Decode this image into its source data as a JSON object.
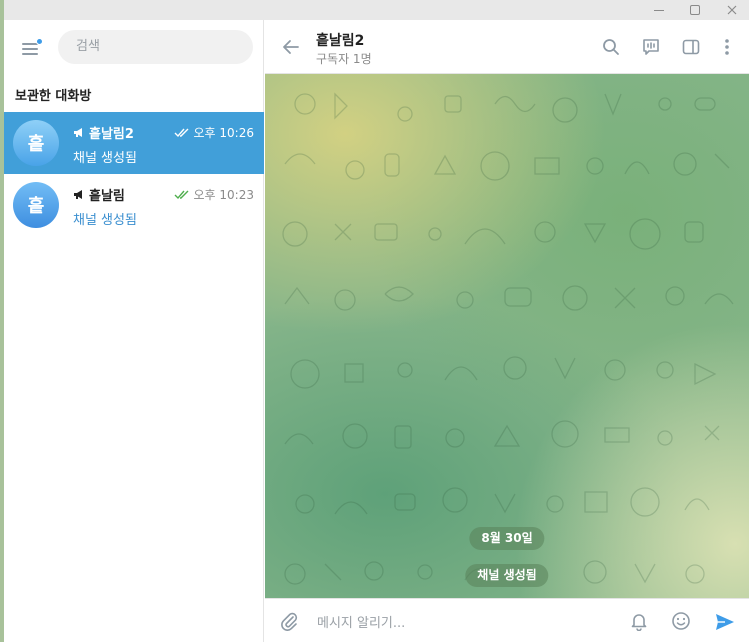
{
  "window": {
    "controls": [
      "minimize-icon",
      "maximize-icon",
      "close-icon"
    ]
  },
  "sidebar": {
    "search_placeholder": "검색",
    "section_title": "보관한 대화방",
    "chats": [
      {
        "avatar_letter": "흩",
        "name": "흩날림2",
        "time": "오후 10:26",
        "preview": "채널 생성됨",
        "icon": "megaphone-icon",
        "read": "double-check-icon",
        "active": true
      },
      {
        "avatar_letter": "흩",
        "name": "흩날림",
        "time": "오후 10:23",
        "preview": "채널 생성됨",
        "icon": "megaphone-icon",
        "read": "double-check-icon",
        "active": false
      }
    ]
  },
  "header": {
    "title": "흩날림2",
    "subtitle": "구독자 1명"
  },
  "messages": {
    "date_label": "8월 30일",
    "service_text": "채널 생성됨"
  },
  "composer": {
    "placeholder": "메시지 알리기..."
  },
  "colors": {
    "accent": "#419fd9",
    "link": "#3b8fd0",
    "send": "#3e9ce8",
    "background_green": "#86b58a"
  }
}
